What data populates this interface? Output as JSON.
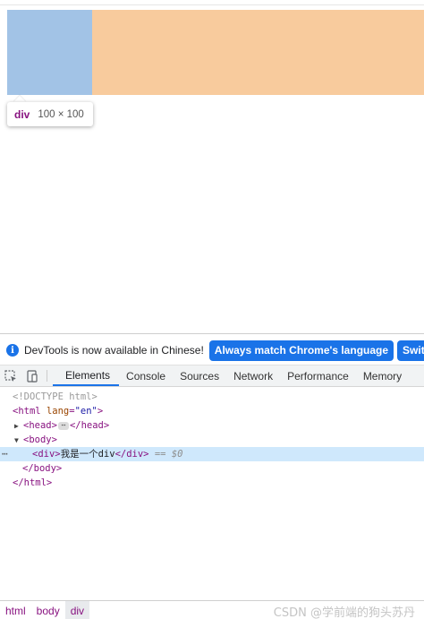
{
  "inspector_tooltip": {
    "tag": "div",
    "dimensions": "100 × 100"
  },
  "infobar": {
    "message": "DevTools is now available in Chinese!",
    "primary_button": "Always match Chrome's language",
    "secondary_button": "Switch DevTo"
  },
  "tabs": [
    "Elements",
    "Console",
    "Sources",
    "Network",
    "Performance",
    "Memory"
  ],
  "active_tab": "Elements",
  "dom": {
    "doctype": "<!DOCTYPE html>",
    "html_open": "<html",
    "lang_attr": "lang",
    "lang_val": "\"en\"",
    "gt": ">",
    "head_open": "<head>",
    "head_close": "</head>",
    "body_open": "<body>",
    "div_open": "<div>",
    "div_text": "我是一个div",
    "div_close": "</div>",
    "eq": "==",
    "dollar": "$0",
    "body_close": "</body>",
    "html_close": "</html>"
  },
  "breadcrumbs": [
    "html",
    "body",
    "div"
  ],
  "watermark": "CSDN @学前端的狗头苏丹",
  "colors": {
    "content_highlight": "#a2c3e6",
    "margin_highlight": "#f8cb9d",
    "accent": "#1a73e8",
    "selected_row": "#cfe8fc"
  }
}
